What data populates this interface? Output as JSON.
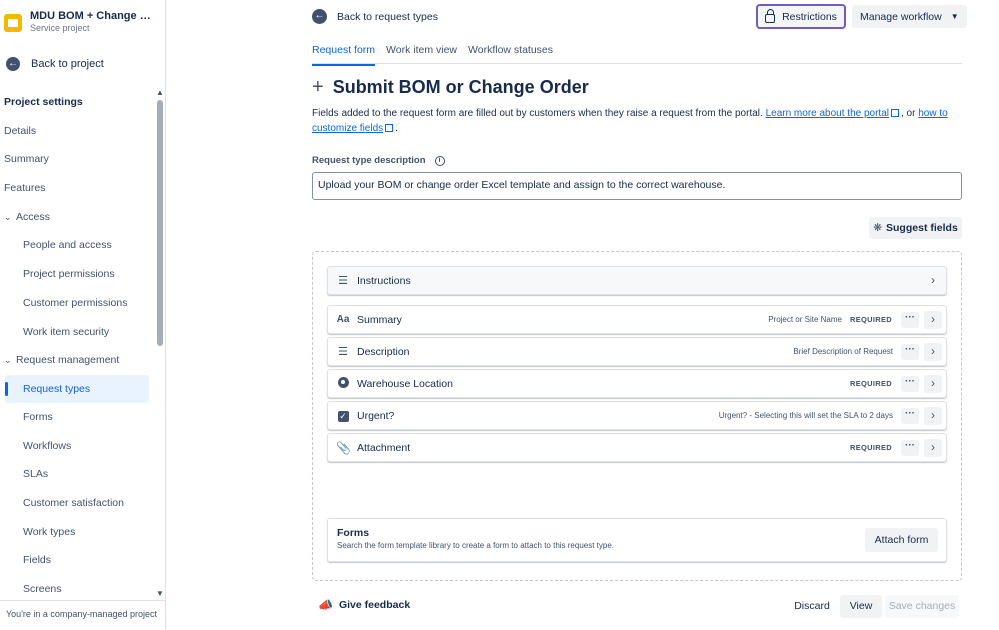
{
  "project": {
    "title": "MDU BOM + Change Or...",
    "subtitle": "Service project",
    "back_label": "Back to project"
  },
  "sidebar": {
    "heading": "Project settings",
    "items": [
      {
        "label": "Details"
      },
      {
        "label": "Summary"
      },
      {
        "label": "Features"
      },
      {
        "label": "Access"
      },
      {
        "label": "People and access"
      },
      {
        "label": "Project permissions"
      },
      {
        "label": "Customer permissions"
      },
      {
        "label": "Work item security"
      },
      {
        "label": "Request management"
      },
      {
        "label": "Request types"
      },
      {
        "label": "Forms"
      },
      {
        "label": "Workflows"
      },
      {
        "label": "SLAs"
      },
      {
        "label": "Customer satisfaction"
      },
      {
        "label": "Work types"
      },
      {
        "label": "Fields"
      },
      {
        "label": "Screens"
      }
    ],
    "footer": "You're in a company-managed project"
  },
  "header": {
    "back_label": "Back to request types",
    "restrictions_label": "Restrictions",
    "workflow_label": "Manage workflow"
  },
  "tabs": [
    {
      "label": "Request form"
    },
    {
      "label": "Work item view"
    },
    {
      "label": "Workflow statuses"
    }
  ],
  "page": {
    "title": "Submit BOM or Change Order",
    "intro_text": "Fields added to the request form are filled out by customers when they raise a request from the portal. ",
    "intro_link1": "Learn more about the portal",
    "intro_or": ", or ",
    "intro_link2a": "how to",
    "intro_link2b": "customize fields",
    "intro_end": ".",
    "desc_label": "Request type description",
    "desc_value": "Upload your BOM or change order Excel template and assign to the correct warehouse.",
    "suggest_label": "Suggest fields"
  },
  "fields": [
    {
      "label": "Instructions",
      "hint": "",
      "required": ""
    },
    {
      "label": "Summary",
      "hint": "Project or Site Name",
      "required": "REQUIRED"
    },
    {
      "label": "Description",
      "hint": "Brief Description of Request",
      "required": ""
    },
    {
      "label": "Warehouse Location",
      "hint": "",
      "required": "REQUIRED"
    },
    {
      "label": "Urgent?",
      "hint": "Urgent? - Selecting this will set the SLA to 2 days",
      "required": ""
    },
    {
      "label": "Attachment",
      "hint": "",
      "required": "REQUIRED"
    }
  ],
  "forms": {
    "title": "Forms",
    "subtitle": "Search the form template library to create a form to attach to this request type.",
    "attach_label": "Attach form"
  },
  "footer": {
    "feedback_label": "Give feedback",
    "discard_label": "Discard",
    "view_label": "View",
    "save_label": "Save changes"
  }
}
